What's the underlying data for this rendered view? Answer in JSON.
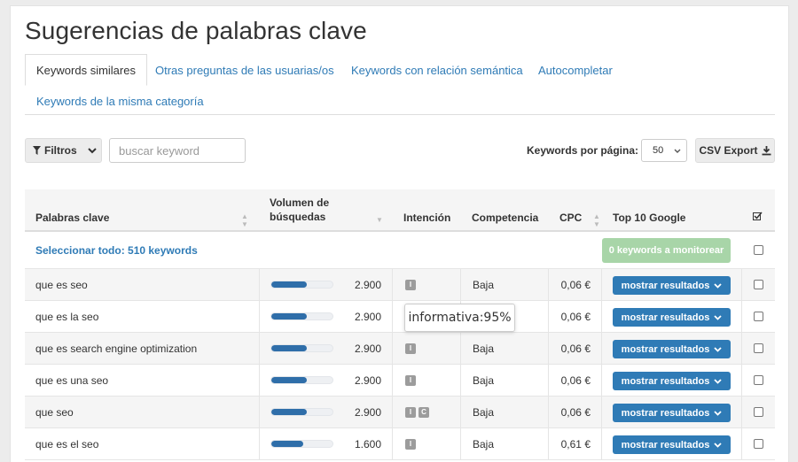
{
  "page": {
    "title": "Sugerencias de palabras clave"
  },
  "tabs": [
    {
      "label": "Keywords similares",
      "active": true
    },
    {
      "label": "Otras preguntas de las usuarias/os"
    },
    {
      "label": "Keywords con relación semántica"
    },
    {
      "label": "Autocompletar"
    },
    {
      "label": "Keywords de la misma categoría"
    }
  ],
  "toolbar": {
    "filter_label": "Filtros",
    "search_placeholder": "buscar keyword",
    "perpage_label": "Keywords por página:",
    "perpage_value": "50",
    "csv_label": "CSV Export"
  },
  "table": {
    "headers": {
      "keyword": "Palabras clave",
      "volume_line1": "Volumen de",
      "volume_line2": "búsquedas",
      "intent": "Intención",
      "competition": "Competencia",
      "cpc": "CPC",
      "top10": "Top 10 Google"
    },
    "select_all": "Seleccionar todo: 510 keywords",
    "monitor_label": "0 keywords a monitorear",
    "show_results_label": "mostrar resultados",
    "rows": [
      {
        "keyword": "que es seo",
        "volume": "2.900",
        "volume_fraction": 0.58,
        "intent": [
          "I"
        ],
        "competition": "Baja",
        "cpc": "0,06 €"
      },
      {
        "keyword": "que es la seo",
        "volume": "2.900",
        "volume_fraction": 0.58,
        "intent": [
          "I"
        ],
        "competition": "Baja",
        "cpc": "0,06 €"
      },
      {
        "keyword": "que es search engine optimization",
        "volume": "2.900",
        "volume_fraction": 0.58,
        "intent": [
          "I"
        ],
        "competition": "Baja",
        "cpc": "0,06 €"
      },
      {
        "keyword": "que es una seo",
        "volume": "2.900",
        "volume_fraction": 0.58,
        "intent": [
          "I"
        ],
        "competition": "Baja",
        "cpc": "0,06 €"
      },
      {
        "keyword": "que seo",
        "volume": "2.900",
        "volume_fraction": 0.58,
        "intent": [
          "I",
          "C"
        ],
        "competition": "Baja",
        "cpc": "0,06 €"
      },
      {
        "keyword": "que es el seo",
        "volume": "1.600",
        "volume_fraction": 0.52,
        "intent": [
          "I"
        ],
        "competition": "Baja",
        "cpc": "0,61 €"
      }
    ]
  },
  "tooltip": {
    "text": "informativa:95%"
  },
  "colors": {
    "link": "#2f7bb6",
    "bar": "#2f6ea9",
    "monitor_button": "#a8d5a8",
    "button": "#2f7bb6"
  }
}
